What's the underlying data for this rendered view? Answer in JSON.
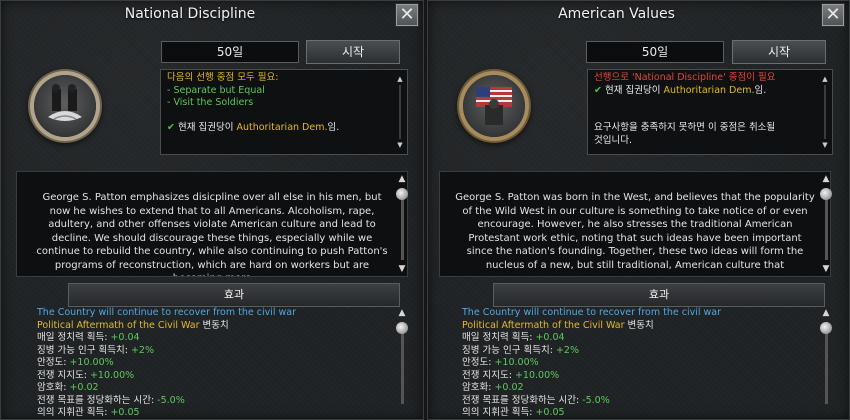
{
  "panels": [
    {
      "title": "National Discipline",
      "close": "✕",
      "days": "50일",
      "start": "시작",
      "icon": "soldiers-handshake-icon",
      "requirements": [
        {
          "text": "다음의 선행 중점 모두 필요:",
          "color": "yellow"
        },
        {
          "text": "- Separate but Equal",
          "color": "green"
        },
        {
          "text": "- Visit the Soldiers",
          "color": "green"
        },
        {
          "text": "",
          "color": "white"
        },
        {
          "prefix": "현재 집권당이 ",
          "highlight": "Authoritarian Dem.",
          "suffix": "임.",
          "check": true
        }
      ],
      "description": "George S. Patton emphasizes disicpline over all else in his men, but now he wishes to extend that to all Americans. Alcoholism, rape, adultery, and other offenses violate American culture and lead to decline. We should discourage these things, especially while we continue to rebuild the country, while also continuing to push Patton's programs of reconstruction, which are hard on workers but are becoming more",
      "effects_label": "효과",
      "effects": [
        {
          "label": "The Country will continue to recover from the civil war",
          "value": "",
          "style": "blue"
        },
        {
          "label": "Political Aftermath of the Civil War",
          "value": " 변동치",
          "style": "gold"
        },
        {
          "label": "매일 정치력 획득: ",
          "value": "+0.04",
          "style": "plain"
        },
        {
          "label": "징병 가능 인구 획득치: ",
          "value": "+2%",
          "style": "plain"
        },
        {
          "label": "안정도: ",
          "value": "+10.00%",
          "style": "plain"
        },
        {
          "label": "전쟁 지지도: ",
          "value": "+10.00%",
          "style": "plain"
        },
        {
          "label": "암호화: ",
          "value": "+0.02",
          "style": "plain"
        },
        {
          "label": "전쟁 목표를 정당화하는 시간: ",
          "value": "-5.0%",
          "style": "plain"
        },
        {
          "label": "의의 지휘관 획득: ",
          "value": "+0.05",
          "style": "plain"
        }
      ]
    },
    {
      "title": "American Values",
      "close": "✕",
      "days": "50일",
      "start": "시작",
      "icon": "american-flag-eagle-icon",
      "requirements": [
        {
          "text": "선행으로 'National Discipline' 중점이 필요",
          "color": "red"
        },
        {
          "prefix": "현재 집권당이 ",
          "highlight": "Authoritarian Dem.",
          "suffix": "임.",
          "check": true
        },
        {
          "text": "",
          "color": "white"
        },
        {
          "text": "",
          "color": "white"
        },
        {
          "text": "요구사항을 충족하지 못하면 이 중점은 취소될",
          "color": "white"
        },
        {
          "text": "것입니다.",
          "color": "white"
        }
      ],
      "description": "George S. Patton was born in the West, and believes that the popularity of the Wild West in our culture is something to take notice of or even encourage. However, he also stresses the traditional American Protestant work ethic, noting that such ideas have been important since the nation's founding. Together, these two ideas will form the nucleus of a new, but still traditional, American culture that",
      "effects_label": "효과",
      "effects": [
        {
          "label": "The Country will continue to recover from the civil war",
          "value": "",
          "style": "blue"
        },
        {
          "label": "Political Aftermath of the Civil War",
          "value": " 변동치",
          "style": "gold"
        },
        {
          "label": "매일 정치력 획득: ",
          "value": "+0.04",
          "style": "plain"
        },
        {
          "label": "징병 가능 인구 획득치: ",
          "value": "+2%",
          "style": "plain"
        },
        {
          "label": "안정도: ",
          "value": "+10.00%",
          "style": "plain"
        },
        {
          "label": "전쟁 지지도: ",
          "value": "+10.00%",
          "style": "plain"
        },
        {
          "label": "암호화: ",
          "value": "+0.02",
          "style": "plain"
        },
        {
          "label": "전쟁 목표를 정당화하는 시간: ",
          "value": "-5.0%",
          "style": "plain"
        },
        {
          "label": "의의 지휘관 획득: ",
          "value": "+0.05",
          "style": "plain"
        }
      ]
    }
  ]
}
